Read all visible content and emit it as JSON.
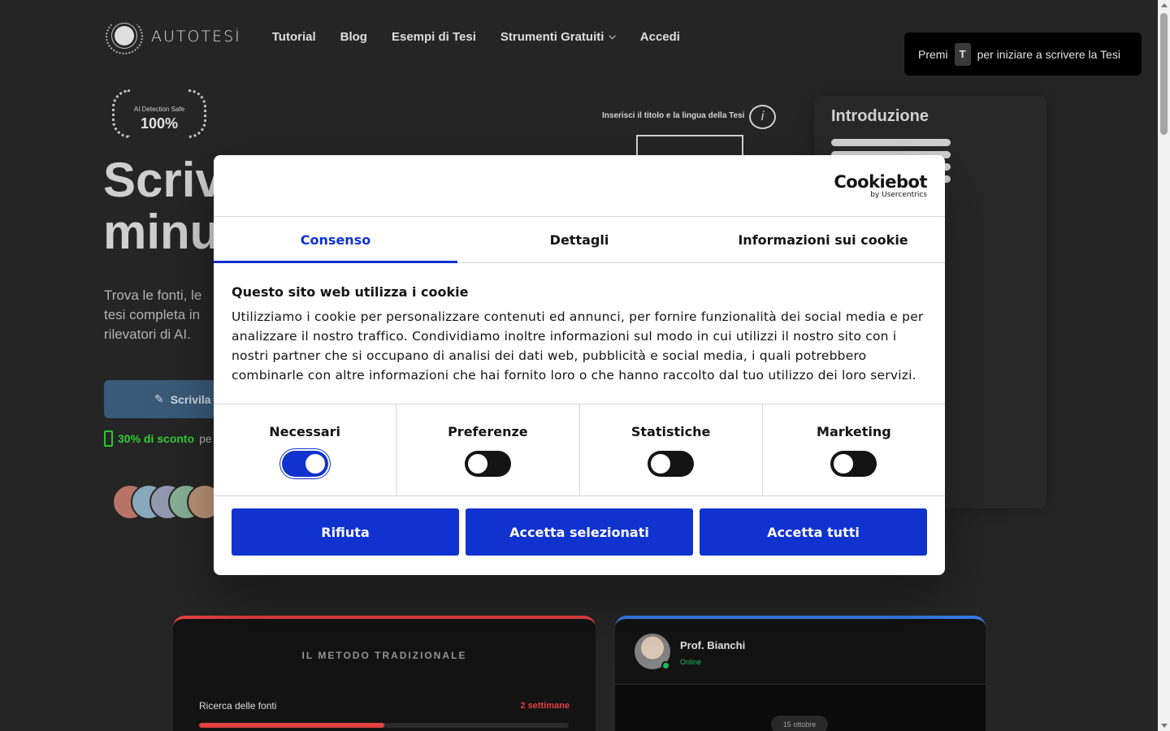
{
  "nav": {
    "logo_text": "AUTOTESİ",
    "links": [
      "Tutorial",
      "Blog",
      "Esempi di Tesi",
      "Strumenti Gratuiti",
      "Accedi"
    ]
  },
  "toast": {
    "prefix": "Premi",
    "key": "T",
    "suffix": "per iniziare a scrivere la Tesi"
  },
  "badge": {
    "line1": "AI Detection Safe",
    "line2": "100%"
  },
  "hero": {
    "title_line1": "Scriv",
    "title_line2": "minu",
    "subtitle": "Trova le fonti, le tesi completa in rilevatori di AI.",
    "cta_label": "Scrivila",
    "discount_highlight": "30% di sconto",
    "discount_rest": "pe"
  },
  "sketch": {
    "note": "Inserisci il titolo e la lingua della Tesi",
    "icon_glyph": "i"
  },
  "paper": {
    "heading": "Introduzione"
  },
  "method_card": {
    "kicker": "IL METODO TRADIZIONALE",
    "row_label": "Ricerca delle fonti",
    "row_value": "2 settimane",
    "progress": 0.5
  },
  "chat_card": {
    "name": "Prof. Bianchi",
    "status": "Online",
    "date": "15 ottobre"
  },
  "cookie_dialog": {
    "brand": "Cookiebot",
    "brand_sub": "by Usercentrics",
    "tabs": [
      "Consenso",
      "Dettagli",
      "Informazioni sui cookie"
    ],
    "active_tab": "Consenso",
    "heading": "Questo sito web utilizza i cookie",
    "body": "Utilizziamo i cookie per personalizzare contenuti ed annunci, per fornire funzionalità dei social media e per analizzare il nostro traffico. Condividiamo inoltre informazioni sul modo in cui utilizzi il nostro sito con i nostri partner che si occupano di analisi dei dati web, pubblicità e social media, i quali potrebbero combinarle con altre informazioni che hai fornito loro o che hanno raccolto dal tuo utilizzo dei loro servizi.",
    "categories": [
      {
        "label": "Necessari",
        "enabled": true
      },
      {
        "label": "Preferenze",
        "enabled": false
      },
      {
        "label": "Statistiche",
        "enabled": false
      },
      {
        "label": "Marketing",
        "enabled": false
      }
    ],
    "buttons": [
      "Rifiuta",
      "Accetta selezionati",
      "Accetta tutti"
    ]
  },
  "colors": {
    "accent": "#1032cf",
    "background": "#262626",
    "danger": "#ef4444",
    "info": "#3b82f6",
    "success": "#22c55e"
  }
}
